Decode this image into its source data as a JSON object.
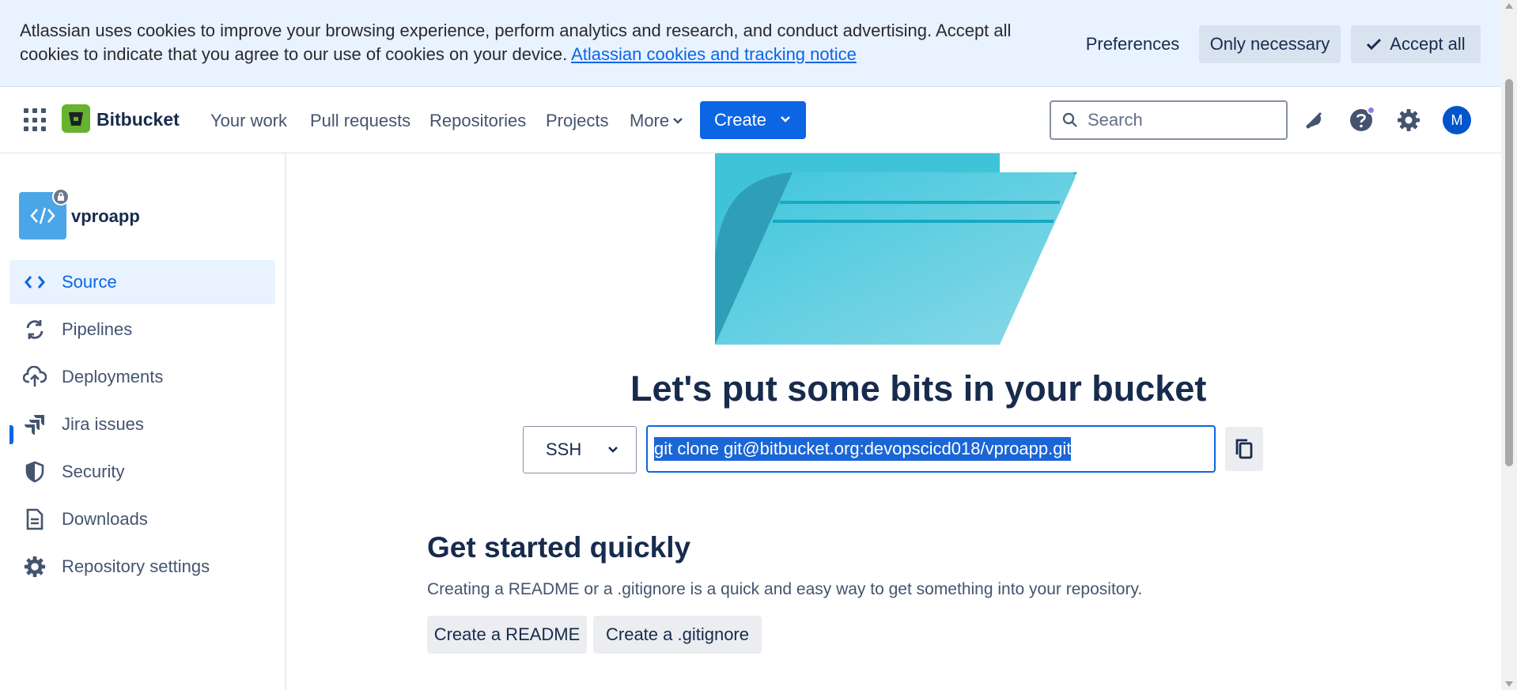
{
  "cookie_banner": {
    "text": "Atlassian uses cookies to improve your browsing experience, perform analytics and research, and conduct advertising. Accept all cookies to indicate that you agree to our use of cookies on your device.",
    "link": "Atlassian cookies and tracking notice",
    "preferences_label": "Preferences",
    "only_necessary_label": "Only necessary",
    "accept_all_label": "Accept all"
  },
  "nav": {
    "product": "Bitbucket",
    "items": [
      "Your work",
      "Pull requests",
      "Repositories",
      "Projects",
      "More"
    ],
    "create_label": "Create",
    "search_placeholder": "Search",
    "avatar_initial": "M"
  },
  "sidebar": {
    "repo_name": "vproapp",
    "items": [
      {
        "label": "Source",
        "icon": "code-icon",
        "active": true
      },
      {
        "label": "Pipelines",
        "icon": "pipelines-icon"
      },
      {
        "label": "Deployments",
        "icon": "cloud-upload-icon"
      },
      {
        "label": "Jira issues",
        "icon": "jira-icon"
      },
      {
        "label": "Security",
        "icon": "shield-icon"
      },
      {
        "label": "Downloads",
        "icon": "document-icon"
      },
      {
        "label": "Repository settings",
        "icon": "gear-icon"
      }
    ]
  },
  "main": {
    "headline": "Let's put some bits in your bucket",
    "protocol": "SSH",
    "clone_command": "git clone git@bitbucket.org:devopscicd018/vproapp.git",
    "get_started_title": "Get started quickly",
    "get_started_desc": "Creating a README or a .gitignore is a quick and easy way to get something into your repository.",
    "readme_button": "Create a README",
    "gitignore_button": "Create a .gitignore"
  },
  "colors": {
    "accent": "#0c66e4",
    "brand_green": "#65b32e",
    "banner_bg": "#e9f2ff",
    "folder_teal": "#3ec6dc"
  }
}
